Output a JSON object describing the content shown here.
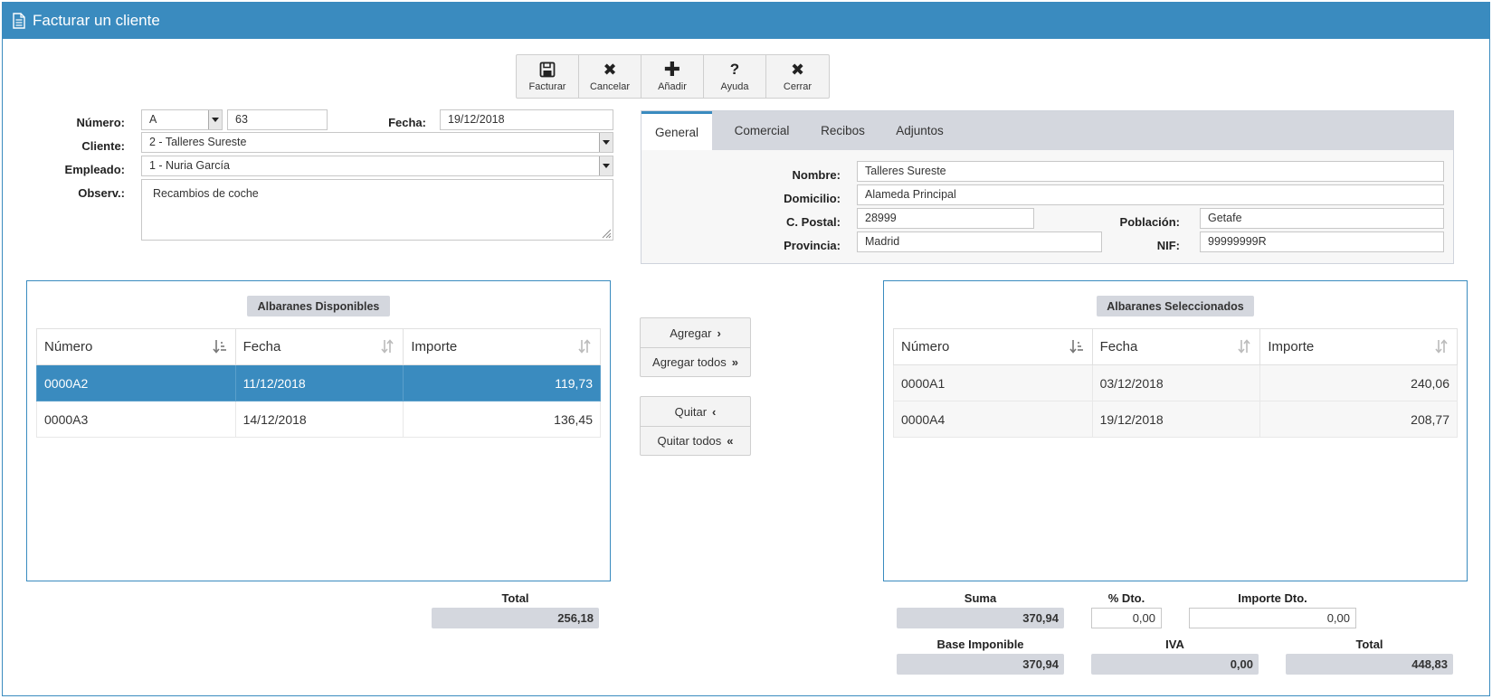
{
  "window": {
    "title": "Facturar un cliente",
    "icon": "document-icon"
  },
  "toolbar": {
    "buttons": [
      {
        "label": "Facturar",
        "icon": "save-icon"
      },
      {
        "label": "Cancelar",
        "icon": "x-icon"
      },
      {
        "label": "Añadir",
        "icon": "plus-icon"
      },
      {
        "label": "Ayuda",
        "icon": "question-icon"
      },
      {
        "label": "Cerrar",
        "icon": "x-icon"
      }
    ]
  },
  "form": {
    "numero_label": "Número:",
    "serie": "A",
    "numero": "63",
    "fecha_label": "Fecha:",
    "fecha": "19/12/2018",
    "cliente_label": "Cliente:",
    "cliente": "2 - Talleres Sureste",
    "empleado_label": "Empleado:",
    "empleado": "1 - Nuria García",
    "observ_label": "Observ.:",
    "observ": "Recambios de coche"
  },
  "tabs": {
    "items": [
      "General",
      "Comercial",
      "Recibos",
      "Adjuntos"
    ],
    "active": "General",
    "general": {
      "nombre_label": "Nombre:",
      "nombre": "Talleres Sureste",
      "domicilio_label": "Domicilio:",
      "domicilio": "Alameda Principal",
      "cpostal_label": "C. Postal:",
      "cpostal": "28999",
      "poblacion_label": "Población:",
      "poblacion": "Getafe",
      "provincia_label": "Provincia:",
      "provincia": "Madrid",
      "nif_label": "NIF:",
      "nif": "99999999R"
    }
  },
  "disponibles": {
    "caption": "Albaranes Disponibles",
    "columns": [
      "Número",
      "Fecha",
      "Importe"
    ],
    "rows": [
      {
        "numero": "0000A2",
        "fecha": "11/12/2018",
        "importe": "119,73",
        "selected": true
      },
      {
        "numero": "0000A3",
        "fecha": "14/12/2018",
        "importe": "136,45",
        "selected": false
      }
    ],
    "total_label": "Total",
    "total": "256,18"
  },
  "seleccionados": {
    "caption": "Albaranes Seleccionados",
    "columns": [
      "Número",
      "Fecha",
      "Importe"
    ],
    "rows": [
      {
        "numero": "0000A1",
        "fecha": "03/12/2018",
        "importe": "240,06"
      },
      {
        "numero": "0000A4",
        "fecha": "19/12/2018",
        "importe": "208,77"
      }
    ]
  },
  "actions": {
    "agregar": "Agregar",
    "agregar_todos": "Agregar todos",
    "quitar": "Quitar",
    "quitar_todos": "Quitar todos"
  },
  "totals": {
    "suma_label": "Suma",
    "suma": "370,94",
    "dto_label": "% Dto.",
    "dto": "0,00",
    "importe_dto_label": "Importe Dto.",
    "importe_dto": "0,00",
    "base_label": "Base Imponible",
    "base": "370,94",
    "iva_label": "IVA",
    "iva": "0,00",
    "total_label": "Total",
    "total": "448,83"
  },
  "colors": {
    "accent": "#3a8bbf",
    "panel": "#d4d7de",
    "selected_row": "#3a8bbf"
  }
}
